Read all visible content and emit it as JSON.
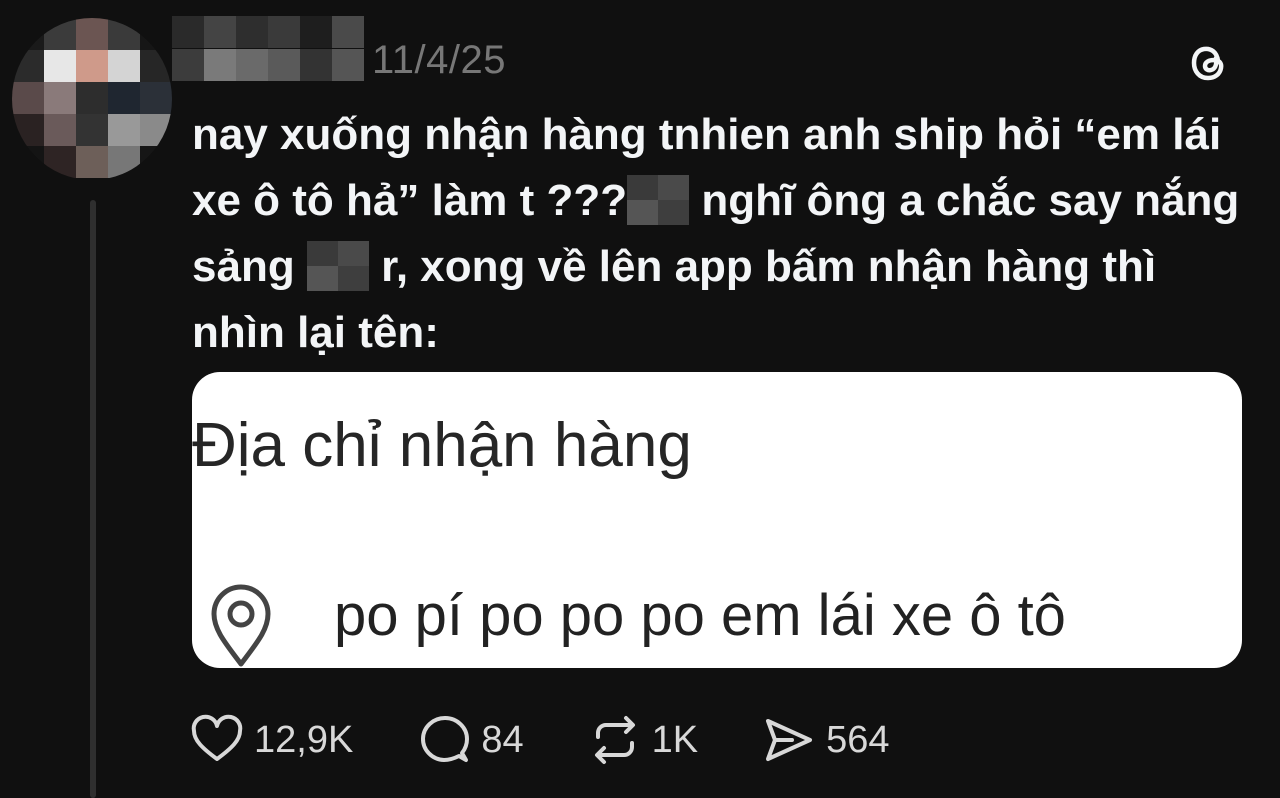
{
  "post": {
    "timestamp": "11/4/25",
    "text": {
      "line1": "nay xuống nhận hàng tnhien anh ship hỏi “em lái",
      "line2_a": "xe ô tô hả” làm t ???",
      "line2_b": " nghĩ ông a chắc say nắng",
      "line3_a": "sảng ",
      "line3_b": " r, xong về lên app bấm nhận hàng thì",
      "line4": "nhìn lại tên:"
    },
    "image": {
      "title": "Địa chỉ nhận hàng",
      "address": "po pí po po po em lái xe ô tô"
    },
    "actions": {
      "likes": "12,9K",
      "replies": "84",
      "reposts": "1K",
      "shares": "564"
    }
  },
  "icons": {
    "app": "threads-logo-icon",
    "like": "heart-icon",
    "reply": "comment-icon",
    "repost": "repost-icon",
    "share": "send-icon",
    "location": "location-pin-icon"
  },
  "colors": {
    "background": "#101010",
    "text": "#f3f5f7",
    "muted": "#777777",
    "card": "#ffffff"
  }
}
